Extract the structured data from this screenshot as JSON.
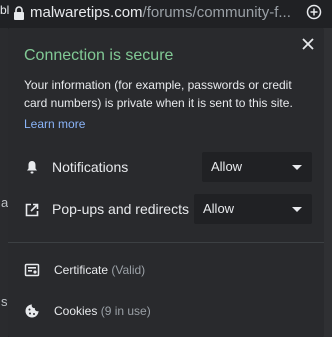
{
  "address_bar": {
    "domain": "malwaretips.com",
    "path": "/forums/community-f..."
  },
  "background_page": {
    "glyph_top": "bl",
    "glyph_a": "a",
    "glyph_s": "s"
  },
  "popup": {
    "title": "Connection is secure",
    "description": "Your information (for example, passwords or credit card numbers) is private when it is sent to this site.",
    "learn_more": "Learn more",
    "permissions": [
      {
        "label": "Notifications",
        "value": "Allow",
        "icon": "bell-icon"
      },
      {
        "label": "Pop-ups and redirects",
        "value": "Allow",
        "icon": "open-in-new-icon"
      }
    ],
    "certificate": {
      "label": "Certificate",
      "status": "(Valid)"
    },
    "cookies": {
      "label": "Cookies",
      "status": "(9 in use)"
    }
  },
  "colors": {
    "secure_green": "#81c995",
    "link_blue": "#8ab4f8",
    "popup_bg": "#292a2d"
  }
}
